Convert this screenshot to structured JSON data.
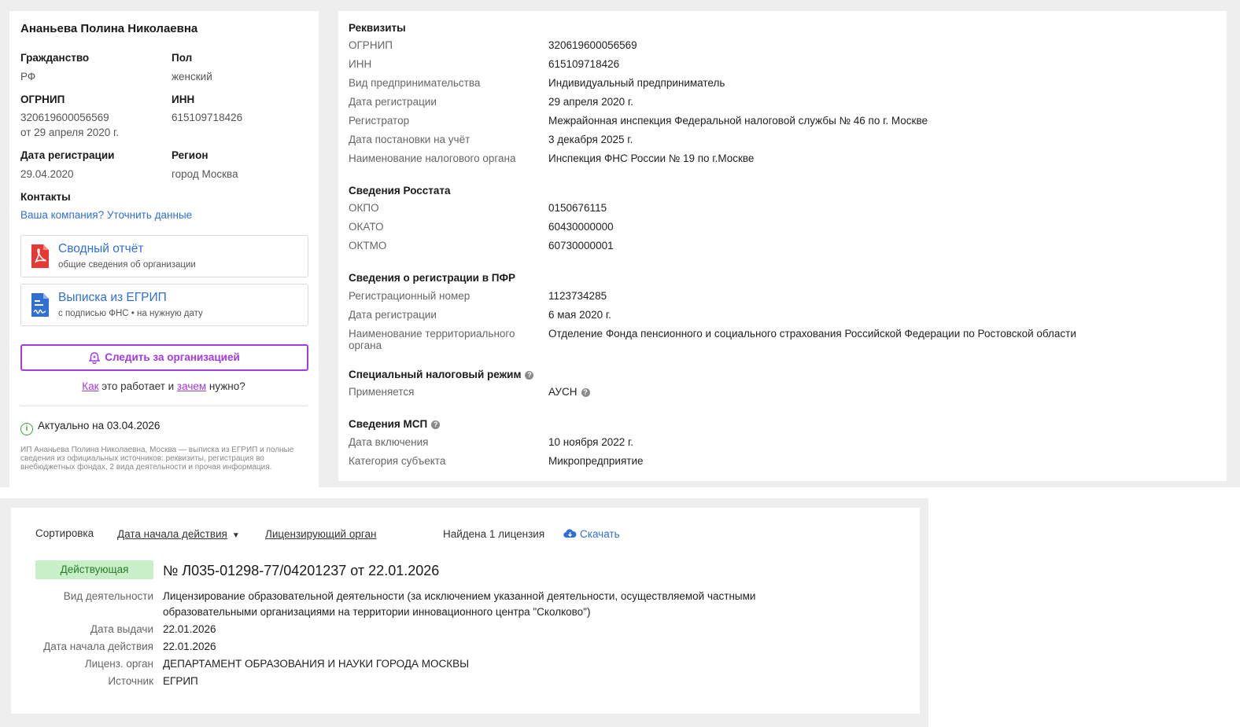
{
  "profile": {
    "name": "Ананьева Полина Николаевна",
    "citizenship_label": "Гражданство",
    "citizenship": "РФ",
    "gender_label": "Пол",
    "gender": "женский",
    "ogrnip_label": "ОГРНИП",
    "ogrnip": "320619600056569",
    "ogrnip_date": "от 29 апреля 2020 г.",
    "inn_label": "ИНН",
    "inn": "615109718426",
    "reg_date_label": "Дата регистрации",
    "reg_date": "29.04.2020",
    "region_label": "Регион",
    "region": "город Москва",
    "contacts_label": "Контакты",
    "contacts_link": "Ваша компания? Уточнить данные"
  },
  "docs": [
    {
      "title": "Сводный отчёт",
      "subtitle": "общие сведения об организации",
      "icon": "pdf-icon"
    },
    {
      "title": "Выписка из ЕГРИП",
      "subtitle": "с подписью ФНС • на нужную дату",
      "icon": "document-signature-icon"
    }
  ],
  "follow": {
    "label": "Следить за организацией",
    "icon": "bell-icon"
  },
  "how": {
    "link1": "Как",
    "text1": " это работает и ",
    "link2": "зачем",
    "text2": " нужно?"
  },
  "actual": "Актуально на 03.04.2026",
  "description": "ИП Ананьева Полина Николаевна, Москва — выписка из ЕГРИП и полные сведения из официальных источников: реквизиты, регистрация во внебюджетных фондах, 2 вида деятельности и прочая информация.",
  "requisites": {
    "title": "Реквизиты",
    "rows": [
      {
        "label": "ОГРНИП",
        "value": "320619600056569"
      },
      {
        "label": "ИНН",
        "value": "615109718426"
      },
      {
        "label": "Вид предпринимательства",
        "value": "Индивидуальный предприниматель"
      },
      {
        "label": "Дата регистрации",
        "value": "29 апреля 2020 г."
      },
      {
        "label": "Регистратор",
        "value": "Межрайонная инспекция Федеральной налоговой службы № 46 по г. Москве"
      },
      {
        "label": "Дата постановки на учёт",
        "value": "3 декабря 2025 г."
      },
      {
        "label": "Наименование налогового органа",
        "value": "Инспекция ФНС России № 19 по г.Москве"
      }
    ]
  },
  "rosstat": {
    "title": "Сведения Росстата",
    "rows": [
      {
        "label": "ОКПО",
        "value": "0150676115"
      },
      {
        "label": "ОКАТО",
        "value": "60430000000"
      },
      {
        "label": "ОКТМО",
        "value": "60730000001"
      }
    ]
  },
  "pfr": {
    "title": "Сведения о регистрации в ПФР",
    "rows": [
      {
        "label": "Регистрационный номер",
        "value": "1123734285"
      },
      {
        "label": "Дата регистрации",
        "value": "6 мая 2020 г."
      },
      {
        "label": "Наименование территориального органа",
        "value": "Отделение Фонда пенсионного и социального страхования Российской Федерации по Ростовской области"
      }
    ]
  },
  "tax_regime": {
    "title": "Специальный налоговый режим",
    "label": "Применяется",
    "value": "АУСН"
  },
  "msp": {
    "title": "Сведения МСП",
    "rows": [
      {
        "label": "Дата включения",
        "value": "10 ноября 2022 г."
      },
      {
        "label": "Категория субъекта",
        "value": "Микропредприятие"
      }
    ]
  },
  "licenses": {
    "sort_label": "Сортировка",
    "sort_options": [
      "Дата начала действия",
      "Лицензирующий орган"
    ],
    "found": "Найдена 1 лицензия",
    "download": "Скачать",
    "status": "Действующая",
    "number": "№ Л035-01298-77/04201237 от 22.01.2026",
    "rows": [
      {
        "label": "Вид деятельности",
        "value": "Лицензирование образовательной деятельности (за исключением указанной деятельности, осуществляемой частными образовательными организациями на территории инновационного центра \"Сколково\")"
      },
      {
        "label": "Дата выдачи",
        "value": "22.01.2026"
      },
      {
        "label": "Дата начала действия",
        "value": "22.01.2026"
      },
      {
        "label": "Лиценз. орган",
        "value": "ДЕПАРТАМЕНТ ОБРАЗОВАНИЯ И НАУКИ ГОРОДА МОСКВЫ"
      },
      {
        "label": "Источник",
        "value": "ЕГРИП"
      }
    ]
  },
  "colors": {
    "accent_purple": "#a33be0",
    "link_blue": "#2f6fd6",
    "status_green_bg": "#c8f0c8",
    "pdf_red": "#e53935"
  }
}
